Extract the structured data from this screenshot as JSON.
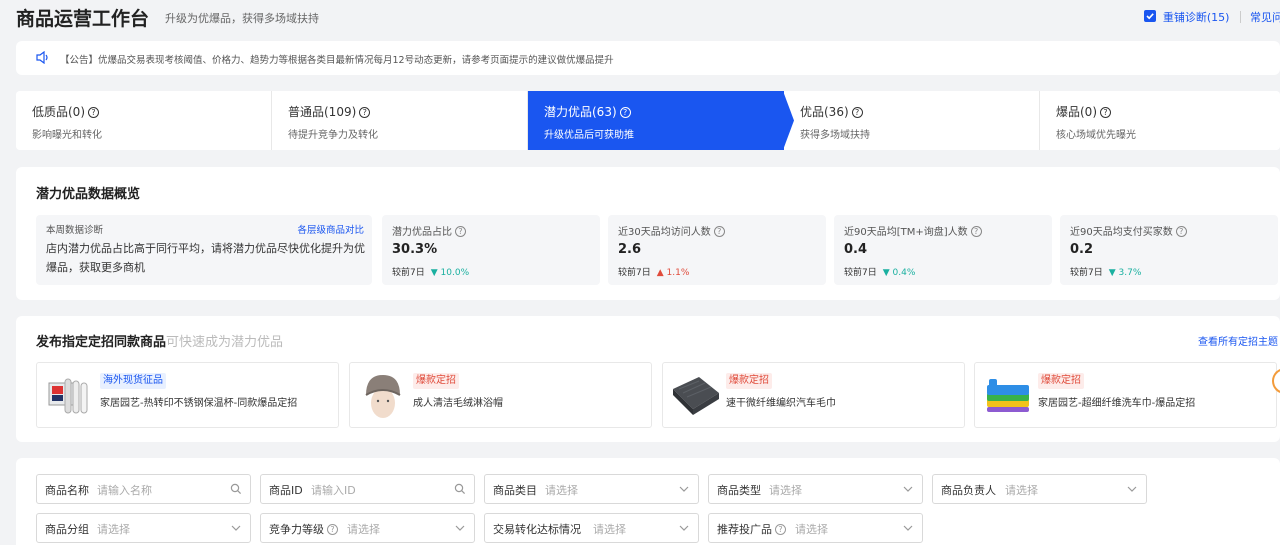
{
  "header": {
    "title": "商品运营工作台",
    "subtitle": "升级为优爆品，获得多场域扶持",
    "rediagnose_label": "重铺诊断(15)",
    "faq_label": "常见问"
  },
  "notice": {
    "text": "【公告】优爆品交易表现考核阈值、价格力、趋势力等根据各类目最新情况每月12号动态更新，请参考页面提示的建议做优爆品提升"
  },
  "stages": [
    {
      "title": "低质品(0)",
      "desc": "影响曝光和转化"
    },
    {
      "title": "普通品(109)",
      "desc": "待提升竞争力及转化"
    },
    {
      "title": "潜力优品(63)",
      "desc": "升级优品后可获助推"
    },
    {
      "title": "优品(36)",
      "desc": "获得多场域扶持"
    },
    {
      "title": "爆品(0)",
      "desc": "核心场域优先曝光"
    }
  ],
  "overview": {
    "title": "潜力优品数据概览",
    "diagnosis": {
      "label": "本周数据诊断",
      "link": "各层级商品对比",
      "text": "店内潜力优品占比高于同行平均，请将潜力优品尽快优化提升为优爆品，获取更多商机"
    },
    "metrics": [
      {
        "label": "潜力优品占比",
        "value": "30.3%",
        "compare": "较前7日",
        "change": "10.0%",
        "dir": "down"
      },
      {
        "label": "近30天品均访问人数",
        "value": "2.6",
        "compare": "较前7日",
        "change": "1.1%",
        "dir": "up"
      },
      {
        "label": "近90天品均[TM+询盘]人数",
        "value": "0.4",
        "compare": "较前7日",
        "change": "0.4%",
        "dir": "down"
      },
      {
        "label": "近90天品均支付买家数",
        "value": "0.2",
        "compare": "较前7日",
        "change": "3.7%",
        "dir": "down"
      }
    ]
  },
  "campaigns": {
    "title": "发布指定定招同款商品",
    "subtitle": "可快速成为潜力优品",
    "link": "查看所有定招主题",
    "items": [
      {
        "tag": "海外现货征品",
        "tag_style": "blue",
        "name": "家居园艺-热转印不锈钢保温杯-同款爆品定招"
      },
      {
        "tag": "爆款定招",
        "tag_style": "red",
        "name": "成人清洁毛绒淋浴帽"
      },
      {
        "tag": "爆款定招",
        "tag_style": "red",
        "name": "速干微纤维编织汽车毛巾"
      },
      {
        "tag": "爆款定招",
        "tag_style": "red",
        "name": "家居园艺-超细纤维洗车巾-爆品定招"
      }
    ]
  },
  "filters": {
    "row1": [
      {
        "label": "商品名称",
        "placeholder": "请输入名称",
        "icon": "search-icon"
      },
      {
        "label": "商品ID",
        "placeholder": "请输入ID",
        "icon": "search-icon"
      },
      {
        "label": "商品类目",
        "placeholder": "请选择",
        "icon": "chevron-down-icon"
      },
      {
        "label": "商品类型",
        "placeholder": "请选择",
        "icon": "chevron-down-icon"
      },
      {
        "label": "商品负责人",
        "placeholder": "请选择",
        "icon": "chevron-down-icon"
      }
    ],
    "row2": [
      {
        "label": "商品分组",
        "placeholder": "请选择",
        "icon": "chevron-down-icon"
      },
      {
        "label": "竞争力等级",
        "placeholder": "请选择",
        "icon": "chevron-down-icon",
        "help": true
      },
      {
        "label": "交易转化达标情况",
        "placeholder": "请选择",
        "icon": "chevron-down-icon"
      },
      {
        "label": "推荐投广品",
        "placeholder": "请选择",
        "icon": "chevron-down-icon",
        "help": true
      }
    ]
  },
  "colors": {
    "accent": "#1a56f0",
    "up": "#e04b3b",
    "down": "#1ab0a0",
    "tag_red_bg": "#fdecea",
    "tag_blue_bg": "#e8f0ff"
  }
}
